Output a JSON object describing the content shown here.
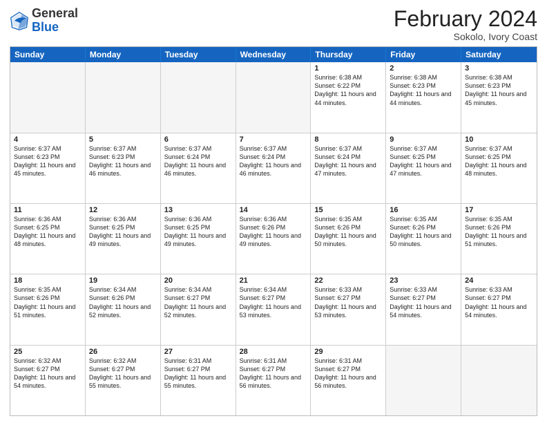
{
  "header": {
    "logo_general": "General",
    "logo_blue": "Blue",
    "month_title": "February 2024",
    "subtitle": "Sokolo, Ivory Coast"
  },
  "days_of_week": [
    "Sunday",
    "Monday",
    "Tuesday",
    "Wednesday",
    "Thursday",
    "Friday",
    "Saturday"
  ],
  "rows": [
    [
      {
        "day": "",
        "text": "",
        "empty": true
      },
      {
        "day": "",
        "text": "",
        "empty": true
      },
      {
        "day": "",
        "text": "",
        "empty": true
      },
      {
        "day": "",
        "text": "",
        "empty": true
      },
      {
        "day": "1",
        "text": "Sunrise: 6:38 AM\nSunset: 6:22 PM\nDaylight: 11 hours and 44 minutes.",
        "empty": false
      },
      {
        "day": "2",
        "text": "Sunrise: 6:38 AM\nSunset: 6:23 PM\nDaylight: 11 hours and 44 minutes.",
        "empty": false
      },
      {
        "day": "3",
        "text": "Sunrise: 6:38 AM\nSunset: 6:23 PM\nDaylight: 11 hours and 45 minutes.",
        "empty": false
      }
    ],
    [
      {
        "day": "4",
        "text": "Sunrise: 6:37 AM\nSunset: 6:23 PM\nDaylight: 11 hours and 45 minutes.",
        "empty": false
      },
      {
        "day": "5",
        "text": "Sunrise: 6:37 AM\nSunset: 6:23 PM\nDaylight: 11 hours and 46 minutes.",
        "empty": false
      },
      {
        "day": "6",
        "text": "Sunrise: 6:37 AM\nSunset: 6:24 PM\nDaylight: 11 hours and 46 minutes.",
        "empty": false
      },
      {
        "day": "7",
        "text": "Sunrise: 6:37 AM\nSunset: 6:24 PM\nDaylight: 11 hours and 46 minutes.",
        "empty": false
      },
      {
        "day": "8",
        "text": "Sunrise: 6:37 AM\nSunset: 6:24 PM\nDaylight: 11 hours and 47 minutes.",
        "empty": false
      },
      {
        "day": "9",
        "text": "Sunrise: 6:37 AM\nSunset: 6:25 PM\nDaylight: 11 hours and 47 minutes.",
        "empty": false
      },
      {
        "day": "10",
        "text": "Sunrise: 6:37 AM\nSunset: 6:25 PM\nDaylight: 11 hours and 48 minutes.",
        "empty": false
      }
    ],
    [
      {
        "day": "11",
        "text": "Sunrise: 6:36 AM\nSunset: 6:25 PM\nDaylight: 11 hours and 48 minutes.",
        "empty": false
      },
      {
        "day": "12",
        "text": "Sunrise: 6:36 AM\nSunset: 6:25 PM\nDaylight: 11 hours and 49 minutes.",
        "empty": false
      },
      {
        "day": "13",
        "text": "Sunrise: 6:36 AM\nSunset: 6:25 PM\nDaylight: 11 hours and 49 minutes.",
        "empty": false
      },
      {
        "day": "14",
        "text": "Sunrise: 6:36 AM\nSunset: 6:26 PM\nDaylight: 11 hours and 49 minutes.",
        "empty": false
      },
      {
        "day": "15",
        "text": "Sunrise: 6:35 AM\nSunset: 6:26 PM\nDaylight: 11 hours and 50 minutes.",
        "empty": false
      },
      {
        "day": "16",
        "text": "Sunrise: 6:35 AM\nSunset: 6:26 PM\nDaylight: 11 hours and 50 minutes.",
        "empty": false
      },
      {
        "day": "17",
        "text": "Sunrise: 6:35 AM\nSunset: 6:26 PM\nDaylight: 11 hours and 51 minutes.",
        "empty": false
      }
    ],
    [
      {
        "day": "18",
        "text": "Sunrise: 6:35 AM\nSunset: 6:26 PM\nDaylight: 11 hours and 51 minutes.",
        "empty": false
      },
      {
        "day": "19",
        "text": "Sunrise: 6:34 AM\nSunset: 6:26 PM\nDaylight: 11 hours and 52 minutes.",
        "empty": false
      },
      {
        "day": "20",
        "text": "Sunrise: 6:34 AM\nSunset: 6:27 PM\nDaylight: 11 hours and 52 minutes.",
        "empty": false
      },
      {
        "day": "21",
        "text": "Sunrise: 6:34 AM\nSunset: 6:27 PM\nDaylight: 11 hours and 53 minutes.",
        "empty": false
      },
      {
        "day": "22",
        "text": "Sunrise: 6:33 AM\nSunset: 6:27 PM\nDaylight: 11 hours and 53 minutes.",
        "empty": false
      },
      {
        "day": "23",
        "text": "Sunrise: 6:33 AM\nSunset: 6:27 PM\nDaylight: 11 hours and 54 minutes.",
        "empty": false
      },
      {
        "day": "24",
        "text": "Sunrise: 6:33 AM\nSunset: 6:27 PM\nDaylight: 11 hours and 54 minutes.",
        "empty": false
      }
    ],
    [
      {
        "day": "25",
        "text": "Sunrise: 6:32 AM\nSunset: 6:27 PM\nDaylight: 11 hours and 54 minutes.",
        "empty": false
      },
      {
        "day": "26",
        "text": "Sunrise: 6:32 AM\nSunset: 6:27 PM\nDaylight: 11 hours and 55 minutes.",
        "empty": false
      },
      {
        "day": "27",
        "text": "Sunrise: 6:31 AM\nSunset: 6:27 PM\nDaylight: 11 hours and 55 minutes.",
        "empty": false
      },
      {
        "day": "28",
        "text": "Sunrise: 6:31 AM\nSunset: 6:27 PM\nDaylight: 11 hours and 56 minutes.",
        "empty": false
      },
      {
        "day": "29",
        "text": "Sunrise: 6:31 AM\nSunset: 6:27 PM\nDaylight: 11 hours and 56 minutes.",
        "empty": false
      },
      {
        "day": "",
        "text": "",
        "empty": true
      },
      {
        "day": "",
        "text": "",
        "empty": true
      }
    ]
  ]
}
